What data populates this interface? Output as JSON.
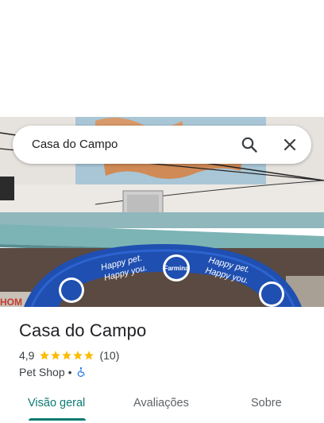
{
  "search": {
    "query": "Casa do Campo"
  },
  "place": {
    "name": "Casa do Campo",
    "rating": "4,9",
    "rating_stars": 5,
    "review_count": "(10)",
    "category": "Pet Shop",
    "separator": "•"
  },
  "photo_banner": {
    "text_line1": "Happy pet.",
    "text_line2": "Happy you.",
    "brand": "Farmina",
    "brand_sub": "Pet Foods"
  },
  "tabs": [
    {
      "label": "Visão geral",
      "active": true
    },
    {
      "label": "Avaliações",
      "active": false
    },
    {
      "label": "Sobre",
      "active": false
    }
  ],
  "colors": {
    "accent": "#0b7a73",
    "star": "#fbbc04",
    "accessibility": "#1a73e8",
    "banner_blue": "#1f4fb0"
  },
  "icons": [
    "search-icon",
    "close-icon",
    "star-icon",
    "wheelchair-accessible-icon"
  ]
}
